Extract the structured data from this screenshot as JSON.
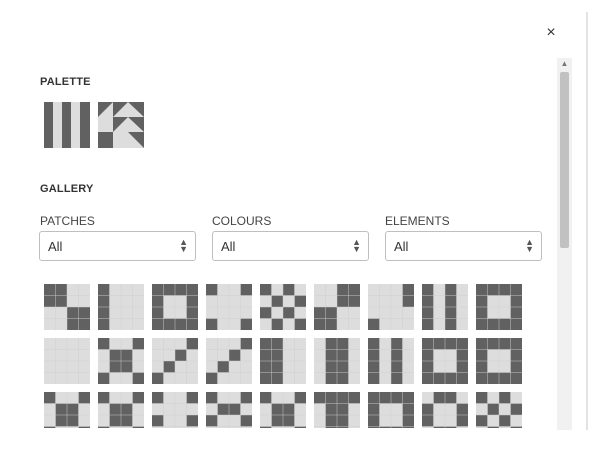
{
  "dialog": {
    "close_label": "×"
  },
  "palette": {
    "title": "PALETTE",
    "tiles": [
      "vertical-stripes-tile",
      "diagonal-triangles-tile"
    ]
  },
  "gallery": {
    "title": "GALLERY",
    "filters": [
      {
        "label": "PATCHES",
        "value": "All"
      },
      {
        "label": "COLOURS",
        "value": "All"
      },
      {
        "label": "ELEMENTS",
        "value": "All"
      }
    ]
  },
  "colors": {
    "dark": "#616161",
    "light": "#dddddd",
    "grid_line": "#cfcfcf",
    "scrollbar_track": "#f1f1f1",
    "scrollbar_thumb": "#c1c1c1"
  }
}
